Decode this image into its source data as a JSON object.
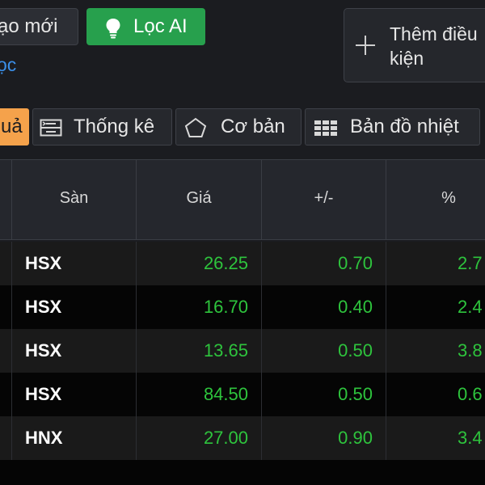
{
  "toolbar": {
    "create_label": "ạo mới",
    "ai_filter_label": "Lọc AI",
    "filter_link": "ọc",
    "add_condition_label": "Thêm điều kiện"
  },
  "tabs": [
    {
      "label": "uả",
      "active": true,
      "icon": ""
    },
    {
      "label": "Thống kê",
      "active": false,
      "icon": "stats-icon"
    },
    {
      "label": "Cơ bản",
      "active": false,
      "icon": "pentagon-icon"
    },
    {
      "label": "Bản đồ nhiệt",
      "active": false,
      "icon": "heatmap-icon"
    }
  ],
  "table": {
    "columns": [
      "Sàn",
      "Giá",
      "+/-",
      "%"
    ],
    "rows": [
      {
        "exchange": "HSX",
        "price": "26.25",
        "change": "0.70",
        "pct": "2.7"
      },
      {
        "exchange": "HSX",
        "price": "16.70",
        "change": "0.40",
        "pct": "2.4"
      },
      {
        "exchange": "HSX",
        "price": "13.65",
        "change": "0.50",
        "pct": "3.8"
      },
      {
        "exchange": "HSX",
        "price": "84.50",
        "change": "0.50",
        "pct": "0.6"
      },
      {
        "exchange": "HNX",
        "price": "27.00",
        "change": "0.90",
        "pct": "3.4"
      }
    ]
  },
  "colors": {
    "background": "#1b1c20",
    "ai_button": "#27a04d",
    "active_tab": "#f5a24b",
    "up_value": "#2ec43d",
    "link": "#3b8fe8"
  }
}
